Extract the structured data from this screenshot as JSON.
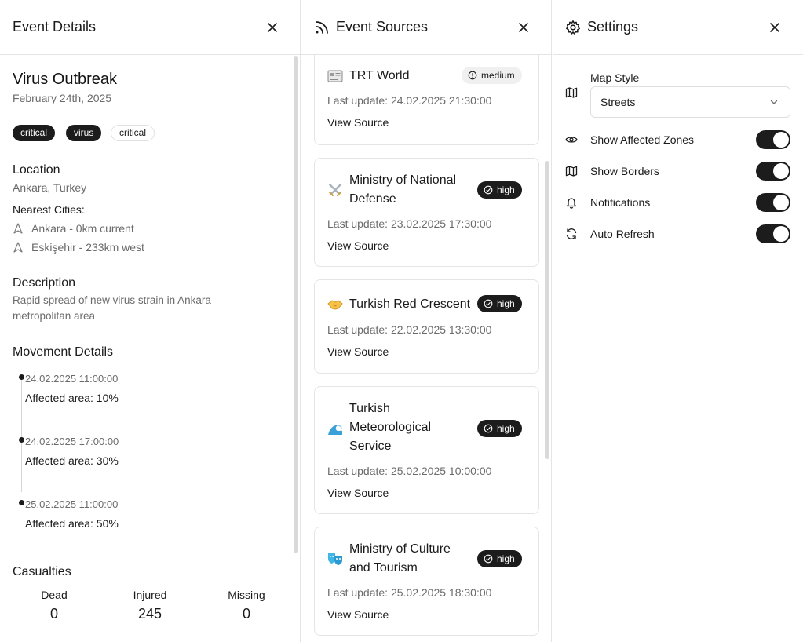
{
  "event_details": {
    "header": "Event Details",
    "title": "Virus Outbreak",
    "date": "February 24th, 2025",
    "tags": [
      "critical",
      "virus",
      "critical"
    ],
    "location_heading": "Location",
    "location": "Ankara, Turkey",
    "nearest_heading": "Nearest Cities:",
    "nearest_cities": [
      "Ankara - 0km current",
      "Eskişehir - 233km west"
    ],
    "description_heading": "Description",
    "description": [
      "Rapid spread of new virus strain in Ankara",
      "metropolitan area"
    ],
    "movement_heading": "Movement Details",
    "movements": [
      {
        "time": "24.02.2025 11:00:00",
        "value": "Affected area: 10%"
      },
      {
        "time": "24.02.2025 17:00:00",
        "value": "Affected area: 30%"
      },
      {
        "time": "25.02.2025 11:00:00",
        "value": "Affected area: 50%"
      }
    ],
    "casualties_heading": "Casualties",
    "casualties": [
      {
        "label": "Dead",
        "value": "0"
      },
      {
        "label": "Injured",
        "value": "245"
      },
      {
        "label": "Missing",
        "value": "0"
      }
    ]
  },
  "event_sources": {
    "header": "Event Sources",
    "link_label": "View Source",
    "sources": [
      {
        "title": "TRT World",
        "badge": "medium",
        "updated": "Last update: 24.02.2025 21:30:00",
        "icon": "newspaper-icon"
      },
      {
        "title_lines": [
          "Ministry of National",
          "Defense"
        ],
        "badge": "high",
        "updated": "Last update: 23.02.2025 17:30:00",
        "icon": "crossed-swords-icon"
      },
      {
        "title": "Turkish Red Crescent",
        "badge": "high",
        "updated": "Last update: 22.02.2025 13:30:00",
        "icon": "handshake-icon"
      },
      {
        "title_lines": [
          "Turkish",
          "Meteorological",
          "Service"
        ],
        "badge": "high",
        "updated": "Last update: 25.02.2025 10:00:00",
        "icon": "wave-icon"
      },
      {
        "title_lines": [
          "Ministry of Culture",
          "and Tourism"
        ],
        "badge": "high",
        "updated": "Last update: 25.02.2025 18:30:00",
        "icon": "theater-masks-icon"
      }
    ]
  },
  "settings": {
    "header": "Settings",
    "map_style_label": "Map Style",
    "map_style_value": "Streets",
    "toggles": [
      {
        "label": "Show Affected Zones",
        "on": true,
        "icon": "eye-icon"
      },
      {
        "label": "Show Borders",
        "on": true,
        "icon": "map-icon"
      },
      {
        "label": "Notifications",
        "on": true,
        "icon": "bell-icon"
      },
      {
        "label": "Auto Refresh",
        "on": true,
        "icon": "refresh-icon"
      }
    ]
  }
}
